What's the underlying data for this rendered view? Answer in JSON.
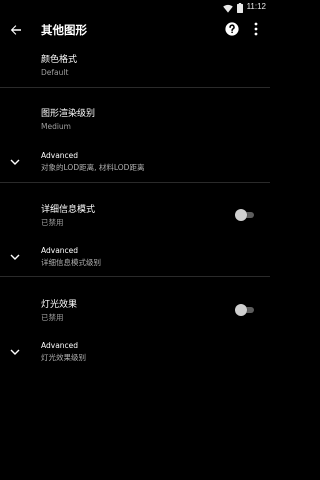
{
  "status_bar": {
    "time": "11:12",
    "icons": [
      "wifi-icon",
      "battery-icon"
    ]
  },
  "toolbar": {
    "title": "其他图形",
    "back_icon": "arrow-back-icon",
    "help_icon": "help-icon",
    "more_icon": "more-vert-icon"
  },
  "prefs": {
    "color_format": {
      "title": "颜色格式",
      "summary": "Default"
    },
    "render_level": {
      "title": "图形渲染级别",
      "summary": "Medium"
    },
    "render_advanced": {
      "title": "Advanced",
      "summary": "对象的LOD距离, 材料LOD距离"
    },
    "detail_mode": {
      "title": "详细信息模式",
      "summary": "已禁用",
      "enabled": false
    },
    "detail_advanced": {
      "title": "Advanced",
      "summary": "详细信息模式级别"
    },
    "lighting": {
      "title": "灯光效果",
      "summary": "已禁用",
      "enabled": false
    },
    "lighting_advanced": {
      "title": "Advanced",
      "summary": "灯光效果级别"
    }
  },
  "colors": {
    "background": "#000000",
    "text_primary": "#ffffff",
    "text_secondary": "#9e9e9e",
    "divider": "#2a2a2a",
    "switch_track_off": "#5d5d5d",
    "switch_thumb_off": "#cfcfcf"
  }
}
